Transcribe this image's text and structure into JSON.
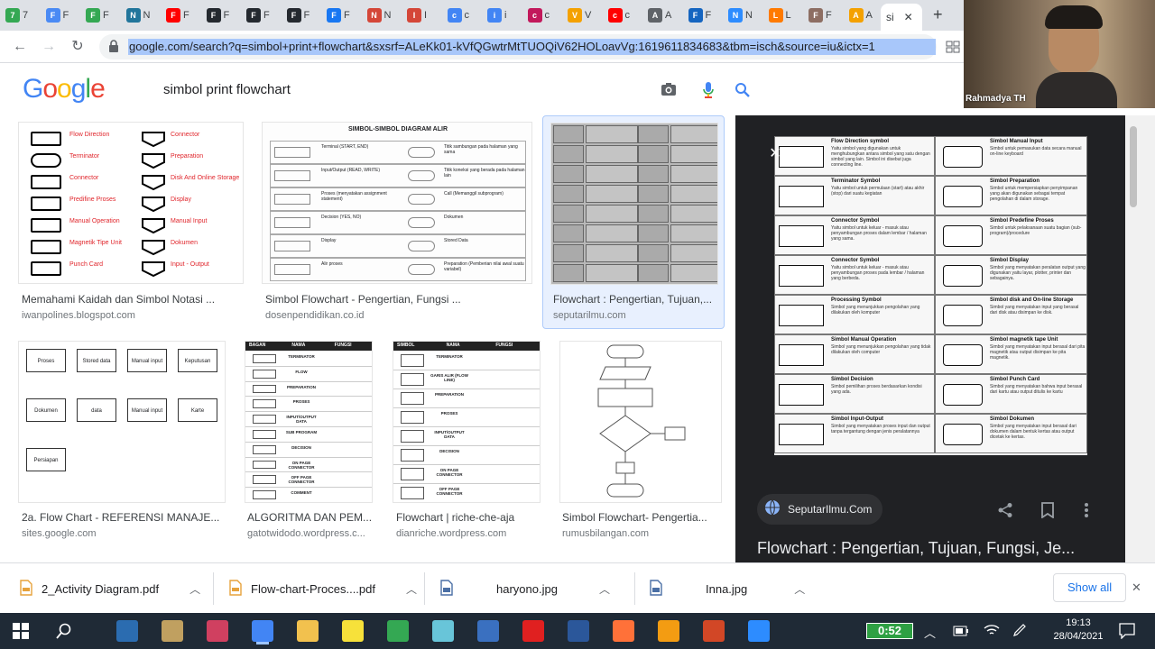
{
  "tabs": [
    {
      "letter": "7",
      "color": "#34a853"
    },
    {
      "letter": "F",
      "color": "#4a8af4"
    },
    {
      "letter": "F",
      "color": "#34a853"
    },
    {
      "letter": "N",
      "color": "#21759b"
    },
    {
      "letter": "F",
      "color": "#ff0000"
    },
    {
      "letter": "F",
      "color": "#24292f"
    },
    {
      "letter": "F",
      "color": "#24292f"
    },
    {
      "letter": "F",
      "color": "#24292f"
    },
    {
      "letter": "F",
      "color": "#1877f2"
    },
    {
      "letter": "N",
      "color": "#d44638"
    },
    {
      "letter": "I",
      "color": "#d44638"
    },
    {
      "letter": "c",
      "color": "#4285f4"
    },
    {
      "letter": "i",
      "color": "#4285f4"
    },
    {
      "letter": "c",
      "color": "#c2185b"
    },
    {
      "letter": "V",
      "color": "#f4a100"
    },
    {
      "letter": "c",
      "color": "#ff0000"
    },
    {
      "letter": "A",
      "color": "#5f6368"
    },
    {
      "letter": "F",
      "color": "#1565c0"
    },
    {
      "letter": "N",
      "color": "#2d8cff"
    },
    {
      "letter": "L",
      "color": "#ff7a00"
    },
    {
      "letter": "F",
      "color": "#8d6e63"
    },
    {
      "letter": "A",
      "color": "#f4a100"
    }
  ],
  "active_tab": {
    "label": "si",
    "close": "✕"
  },
  "new_tab": "+",
  "toolbar": {
    "back": "←",
    "forward": "→",
    "reload": "↻",
    "url": "google.com/search?q=simbol+print+flowchart&sxsrf=ALeKk01-kVfQGwtrMtTUOQiV62HOLoavVg:1619611834683&tbm=isch&source=iu&ictx=1"
  },
  "google": {
    "logo": [
      "G",
      "o",
      "o",
      "g",
      "l",
      "e"
    ],
    "logo_colors": [
      "#4285f4",
      "#ea4335",
      "#fbbc05",
      "#4285f4",
      "#34a853",
      "#ea4335"
    ],
    "query": "simbol print flowchart"
  },
  "results": [
    {
      "caption": "Memahami Kaidah dan Simbol Notasi ...",
      "source": "iwanpolines.blogspot.com"
    },
    {
      "caption": "Simbol Flowchart - Pengertian, Fungsi ...",
      "source": "dosenpendidikan.co.id"
    },
    {
      "caption": "Flowchart : Pengertian, Tujuan,...",
      "source": "seputarilmu.com"
    },
    {
      "caption": "2a. Flow Chart - REFERENSI MANAJE...",
      "source": "sites.google.com"
    },
    {
      "caption": "ALGORITMA DAN PEM...",
      "source": "gatotwidodo.wordpress.c..."
    },
    {
      "caption": "Flowchart | riche-che-aja",
      "source": "dianriche.wordpress.com"
    },
    {
      "caption": "Simbol Flowchart- Pengertia...",
      "source": "rumusbilangan.com"
    }
  ],
  "thumb1": {
    "left": [
      "Flow Direction",
      "Terminator",
      "Connector",
      "Predifine Proses",
      "Manual Operation",
      "Magnetik Tipe Unit",
      "Punch Card"
    ],
    "right": [
      "Connector",
      "Preparation",
      "Disk And Online Storage",
      "Display",
      "Manual Input",
      "Dokumen",
      "Input - Output"
    ]
  },
  "thumb2": {
    "title": "SIMBOL-SIMBOL DIAGRAM ALIR",
    "rows": [
      "Terminal (START, END)",
      "Input/Output (READ, WRITE)",
      "Proses (menyatakan assignment statement)",
      "Decision (YES, NO)",
      "Display",
      "Alir proses"
    ],
    "rows2": [
      "Titik sambungan pada halaman yang sama",
      "Titik koneksi yang berada pada halaman lain",
      "Call (Memanggil subprogram)",
      "Dokumen",
      "Stored Data",
      "Preparation (Pemberian nilai awal suatu variabel)"
    ]
  },
  "thumb5": {
    "headers": [
      "BAGAN",
      "NAMA",
      "FUNGSI"
    ],
    "names": [
      "TERMINATOR",
      "FLOW",
      "PREPARATION",
      "PROSES",
      "INPUT/OUTPUT DATA",
      "SUB PROGRAM",
      "DECISION",
      "ON PAGE CONNECTOR",
      "OFF PAGE CONNECTOR",
      "COMMENT"
    ]
  },
  "thumb6": {
    "headers": [
      "SIMBOL",
      "NAMA",
      "FUNGSI"
    ],
    "names": [
      "TERMINATOR",
      "GARIS ALIR (FLOW LINE)",
      "PREPARATION",
      "PROSES",
      "INPUT/OUTPUT DATA",
      "DECISION",
      "ON PAGE CONNECTOR",
      "OFF PAGE CONNECTOR"
    ]
  },
  "thumb4": {
    "labels": [
      "Proses",
      "Stored data",
      "Manual input",
      "Keputusan",
      "Dokumen",
      "data",
      "Manual input",
      "Karte",
      "Persiapan"
    ]
  },
  "panel": {
    "image_rows": [
      {
        "l": "Flow Direction symbol",
        "lt": "Yaitu simbol yang digunakan untuk menghubungkan antara simbol yang satu dengan simbol yang lain. Simbol ini disebut juga connecting line.",
        "r": "Simbol Manual Input",
        "rt": "Simbol untuk pemasukan data secara manual on-line keyboard"
      },
      {
        "l": "Terminator Symbol",
        "lt": "Yaitu simbol untuk permulaan (start) atau akhir (stop) dari suatu kegiatan",
        "r": "Simbol Preparation",
        "rt": "Simbol untuk mempersiapkan penyimpanan yang akan digunakan sebagai tempat pengolahan di dalam storage."
      },
      {
        "l": "Connector Symbol",
        "lt": "Yaitu simbol untuk keluar - masuk atau penyambungan proses dalam lembar / halaman yang sama.",
        "r": "Simbol Predefine Proses",
        "rt": "Simbol untuk pelaksanaan suatu bagian (sub-program)/procedure"
      },
      {
        "l": "Connector Symbol",
        "lt": "Yaitu simbol untuk keluar - masuk atau penyambungan proses pada lembar / halaman yang berbeda.",
        "r": "Simbol Display",
        "rt": "Simbol yang menyatakan peralatan output yang digunakan yaitu layar, plotter, printer dan sebagainya."
      },
      {
        "l": "Processing Symbol",
        "lt": "Simbol yang menunjukkan pengolahan yang dilakukan oleh komputer",
        "r": "Simbol disk and On-line Storage",
        "rt": "Simbol yang menyatakan input yang berasal dari disk atau disimpan ke disk."
      },
      {
        "l": "Simbol Manual Operation",
        "lt": "Simbol yang menunjukkan pengolahan yang tidak dilakukan oleh computer",
        "r": "Simbol magnetik tape Unit",
        "rt": "Simbol yang menyatakan input berasal dari pita magnetik atau output disimpan ke pita magnetik."
      },
      {
        "l": "Simbol Decision",
        "lt": "Simbol pemilihan proses berdasarkan kondisi yang ada.",
        "r": "Simbol Punch Card",
        "rt": "Simbol yang menyatakan bahwa input berasal dari kartu atau output ditulis ke kartu"
      },
      {
        "l": "Simbol Input-Output",
        "lt": "Simbol yang menyatakan proses input dan output tanpa tergantung dengan jenis peralatannya",
        "r": "Simbol Dokumen",
        "rt": "Simbol yang menyatakan input berasal dari dokumen dalam bentuk kertas atau output dicetak ke kertas."
      }
    ],
    "source_name": "SeputarIlmu.Com",
    "title": "Flowchart : Pengertian, Tujuan, Fungsi, Je...",
    "close": "✕"
  },
  "webcam": {
    "name": "Rahmadya TH"
  },
  "downloads": [
    {
      "name": "2_Activity Diagram.pdf",
      "type": "pdf"
    },
    {
      "name": "Flow-chart-Proces....pdf",
      "type": "pdf"
    },
    {
      "name": "haryono.jpg",
      "type": "jpg"
    },
    {
      "name": "Inna.jpg",
      "type": "jpg"
    }
  ],
  "downloads_show_all": "Show all",
  "downloads_close": "✕",
  "taskbar": {
    "battery": "0:52",
    "time": "19:13",
    "date": "28/04/2021",
    "icons": [
      {
        "name": "calculator-icon",
        "color": "#2b6cb0"
      },
      {
        "name": "paint-icon",
        "color": "#c0a060"
      },
      {
        "name": "snip-icon",
        "color": "#d04060"
      },
      {
        "name": "chrome-icon",
        "color": "#4285f4"
      },
      {
        "name": "file-explorer-icon",
        "color": "#f2c14e"
      },
      {
        "name": "sticky-notes-icon",
        "color": "#f7e13a"
      },
      {
        "name": "chrome-alt-icon",
        "color": "#34a853"
      },
      {
        "name": "app-teal-icon",
        "color": "#68c5d9"
      },
      {
        "name": "network-app-icon",
        "color": "#3a70c0"
      },
      {
        "name": "red-app-icon",
        "color": "#e02020"
      },
      {
        "name": "word-icon",
        "color": "#2b579a"
      },
      {
        "name": "firefox-icon",
        "color": "#ff7139"
      },
      {
        "name": "presenter-icon",
        "color": "#f39c12"
      },
      {
        "name": "powerpoint-icon",
        "color": "#d24726"
      },
      {
        "name": "zoom-icon",
        "color": "#2d8cff"
      }
    ]
  }
}
